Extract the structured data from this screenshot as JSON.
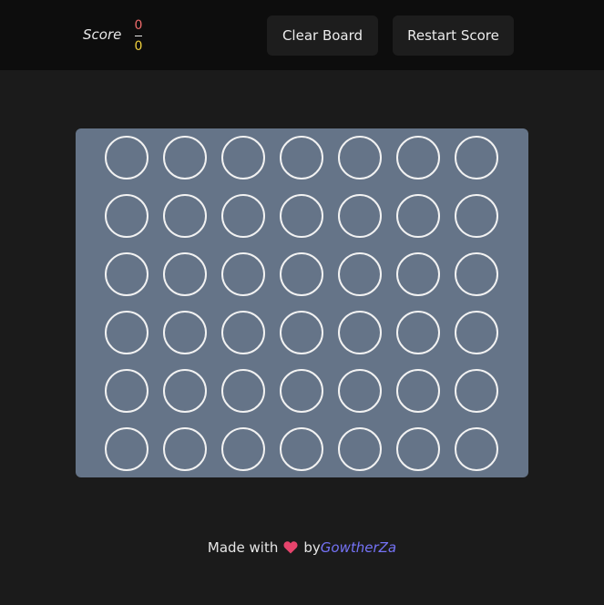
{
  "header": {
    "score_label": "Score",
    "score_player1": "0",
    "score_player2": "0",
    "clear_board_label": "Clear Board",
    "restart_score_label": "Restart Score"
  },
  "board": {
    "rows": 6,
    "columns": 7,
    "cells_filled": 0
  },
  "footer": {
    "made_with": "Made with",
    "by": "by",
    "author": "GowtherZa",
    "heart_icon": "heart-icon"
  },
  "colors": {
    "player1": "#ef6b6b",
    "player2": "#f1d13c",
    "board": "#657488",
    "link": "#7472f5"
  }
}
